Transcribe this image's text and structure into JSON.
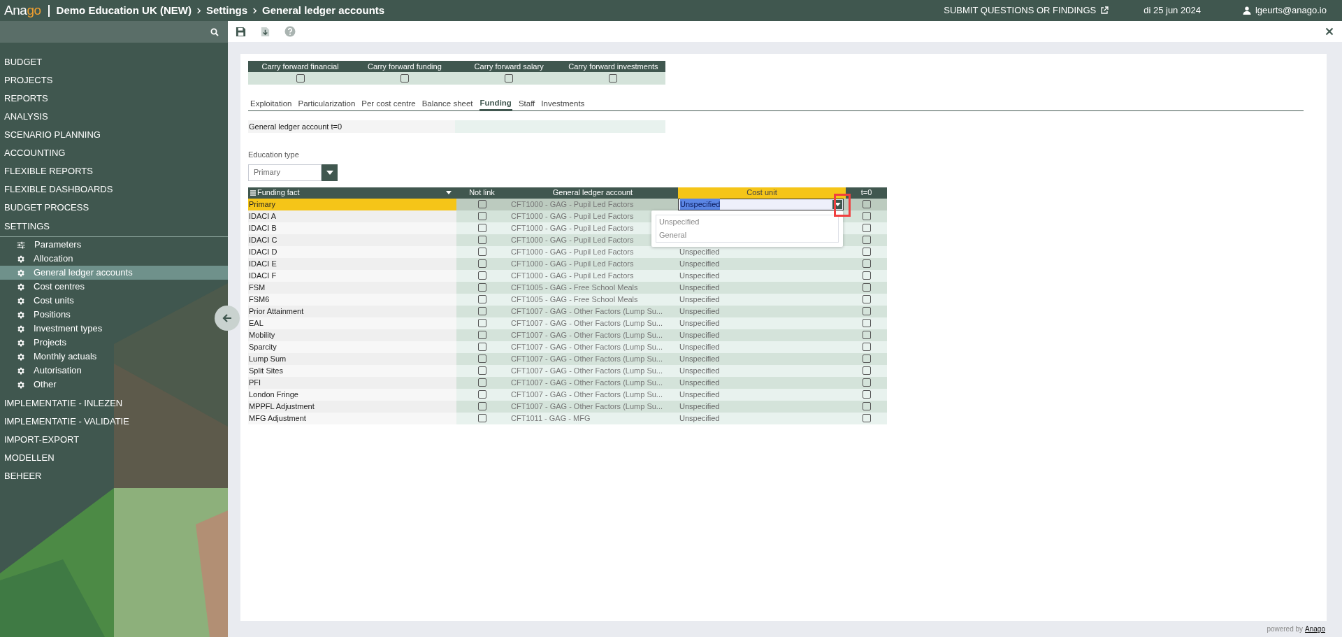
{
  "header": {
    "logo": {
      "main": "Ana",
      "accent": "go"
    },
    "breadcrumb": [
      "Demo Education UK (NEW)",
      "Settings",
      "General ledger accounts"
    ],
    "feedback_link": "SUBMIT QUESTIONS OR FINDINGS",
    "date": "di 25 jun 2024",
    "user": "lgeurts@anago.io"
  },
  "sidebar": {
    "items": [
      {
        "label": "BUDGET"
      },
      {
        "label": "PROJECTS"
      },
      {
        "label": "REPORTS"
      },
      {
        "label": "ANALYSIS"
      },
      {
        "label": "SCENARIO PLANNING"
      },
      {
        "label": "ACCOUNTING"
      },
      {
        "label": "FLEXIBLE REPORTS"
      },
      {
        "label": "FLEXIBLE DASHBOARDS"
      },
      {
        "label": "BUDGET PROCESS"
      },
      {
        "label": "SETTINGS",
        "expanded": true,
        "children": [
          {
            "label": "Parameters",
            "kind": "sliders",
            "selected": false
          },
          {
            "label": "Allocation",
            "kind": "gear",
            "selected": false
          },
          {
            "label": "General ledger accounts",
            "kind": "gear",
            "selected": true
          },
          {
            "label": "Cost centres",
            "kind": "gear",
            "selected": false
          },
          {
            "label": "Cost units",
            "kind": "gear",
            "selected": false
          },
          {
            "label": "Positions",
            "kind": "gear",
            "selected": false
          },
          {
            "label": "Investment types",
            "kind": "gear",
            "selected": false
          },
          {
            "label": "Projects",
            "kind": "gear",
            "selected": false
          },
          {
            "label": "Monthly actuals",
            "kind": "gear",
            "selected": false
          },
          {
            "label": "Autorisation",
            "kind": "gear",
            "selected": false
          },
          {
            "label": "Other",
            "kind": "gear",
            "selected": false
          }
        ]
      },
      {
        "label": "IMPLEMENTATIE - INLEZEN"
      },
      {
        "label": "IMPLEMENTATIE - VALIDATIE"
      },
      {
        "label": "IMPORT-EXPORT"
      },
      {
        "label": "MODELLEN"
      },
      {
        "label": "BEHEER"
      }
    ]
  },
  "carry_forward": [
    {
      "label": "Carry forward financial",
      "checked": false
    },
    {
      "label": "Carry forward funding",
      "checked": false
    },
    {
      "label": "Carry forward salary",
      "checked": false
    },
    {
      "label": "Carry forward investments",
      "checked": false
    }
  ],
  "tabs": [
    {
      "label": "Exploitation",
      "selected": false
    },
    {
      "label": "Particularization",
      "selected": false
    },
    {
      "label": "Per cost centre",
      "selected": false
    },
    {
      "label": "Balance sheet",
      "selected": false
    },
    {
      "label": "Funding",
      "selected": true
    },
    {
      "label": "Staff",
      "selected": false
    },
    {
      "label": "Investments",
      "selected": false
    }
  ],
  "gl_account_t0": {
    "label": "General ledger account t=0"
  },
  "education_type": {
    "label": "Education type",
    "value": "Primary"
  },
  "table": {
    "columns": [
      {
        "label": "Funding fact",
        "selected": false
      },
      {
        "label": "Not link",
        "selected": false
      },
      {
        "label": "General ledger account",
        "selected": false
      },
      {
        "label": "Cost unit",
        "selected": true
      },
      {
        "label": "t=0",
        "selected": false
      }
    ],
    "rows": [
      {
        "funding_fact": "Primary",
        "not_link": false,
        "gl_account": "CFT1000 - GAG - Pupil Led Factors",
        "cost_unit": "Unspecified",
        "t0": false,
        "selected": true
      },
      {
        "funding_fact": "IDACI A",
        "not_link": false,
        "gl_account": "CFT1000 - GAG - Pupil Led Factors",
        "t0": false,
        "selected": false
      },
      {
        "funding_fact": "IDACI B",
        "not_link": false,
        "gl_account": "CFT1000 - GAG - Pupil Led Factors",
        "t0": false,
        "selected": false
      },
      {
        "funding_fact": "IDACI C",
        "not_link": false,
        "gl_account": "CFT1000 - GAG - Pupil Led Factors",
        "t0": false,
        "selected": false
      },
      {
        "funding_fact": "IDACI D",
        "not_link": false,
        "gl_account": "CFT1000 - GAG - Pupil Led Factors",
        "cost_unit": "Unspecified",
        "t0": false,
        "selected": false
      },
      {
        "funding_fact": "IDACI E",
        "not_link": false,
        "gl_account": "CFT1000 - GAG - Pupil Led Factors",
        "cost_unit": "Unspecified",
        "t0": false,
        "selected": false
      },
      {
        "funding_fact": "IDACI F",
        "not_link": false,
        "gl_account": "CFT1000 - GAG - Pupil Led Factors",
        "cost_unit": "Unspecified",
        "t0": false,
        "selected": false
      },
      {
        "funding_fact": "FSM",
        "not_link": false,
        "gl_account": "CFT1005 - GAG - Free School Meals",
        "cost_unit": "Unspecified",
        "t0": false,
        "selected": false
      },
      {
        "funding_fact": "FSM6",
        "not_link": false,
        "gl_account": "CFT1005 - GAG - Free School Meals",
        "cost_unit": "Unspecified",
        "t0": false,
        "selected": false
      },
      {
        "funding_fact": "Prior Attainment",
        "not_link": false,
        "gl_account": "CFT1007 - GAG - Other Factors (Lump Su...",
        "cost_unit": "Unspecified",
        "t0": false,
        "selected": false
      },
      {
        "funding_fact": "EAL",
        "not_link": false,
        "gl_account": "CFT1007 - GAG - Other Factors (Lump Su...",
        "cost_unit": "Unspecified",
        "t0": false,
        "selected": false
      },
      {
        "funding_fact": "Mobility",
        "not_link": false,
        "gl_account": "CFT1007 - GAG - Other Factors (Lump Su...",
        "cost_unit": "Unspecified",
        "t0": false,
        "selected": false
      },
      {
        "funding_fact": "Sparcity",
        "not_link": false,
        "gl_account": "CFT1007 - GAG - Other Factors (Lump Su...",
        "cost_unit": "Unspecified",
        "t0": false,
        "selected": false
      },
      {
        "funding_fact": "Lump Sum",
        "not_link": false,
        "gl_account": "CFT1007 - GAG - Other Factors (Lump Su...",
        "cost_unit": "Unspecified",
        "t0": false,
        "selected": false
      },
      {
        "funding_fact": "Split Sites",
        "not_link": false,
        "gl_account": "CFT1007 - GAG - Other Factors (Lump Su...",
        "cost_unit": "Unspecified",
        "t0": false,
        "selected": false
      },
      {
        "funding_fact": "PFI",
        "not_link": false,
        "gl_account": "CFT1007 - GAG - Other Factors (Lump Su...",
        "cost_unit": "Unspecified",
        "t0": false,
        "selected": false
      },
      {
        "funding_fact": "London Fringe",
        "not_link": false,
        "gl_account": "CFT1007 - GAG - Other Factors (Lump Su...",
        "cost_unit": "Unspecified",
        "t0": false,
        "selected": false
      },
      {
        "funding_fact": "MPPFL Adjustment",
        "not_link": false,
        "gl_account": "CFT1007 - GAG - Other Factors (Lump Su...",
        "cost_unit": "Unspecified",
        "t0": false,
        "selected": false
      },
      {
        "funding_fact": "MFG Adjustment",
        "not_link": false,
        "gl_account": "CFT1011 - GAG - MFG",
        "cost_unit": "Unspecified",
        "t0": false,
        "selected": false
      }
    ],
    "cost_unit_dropdown": {
      "options": [
        {
          "label": "Unspecified"
        },
        {
          "label": "General"
        }
      ]
    }
  },
  "footer": {
    "text": "powered by",
    "link": "Anago"
  }
}
